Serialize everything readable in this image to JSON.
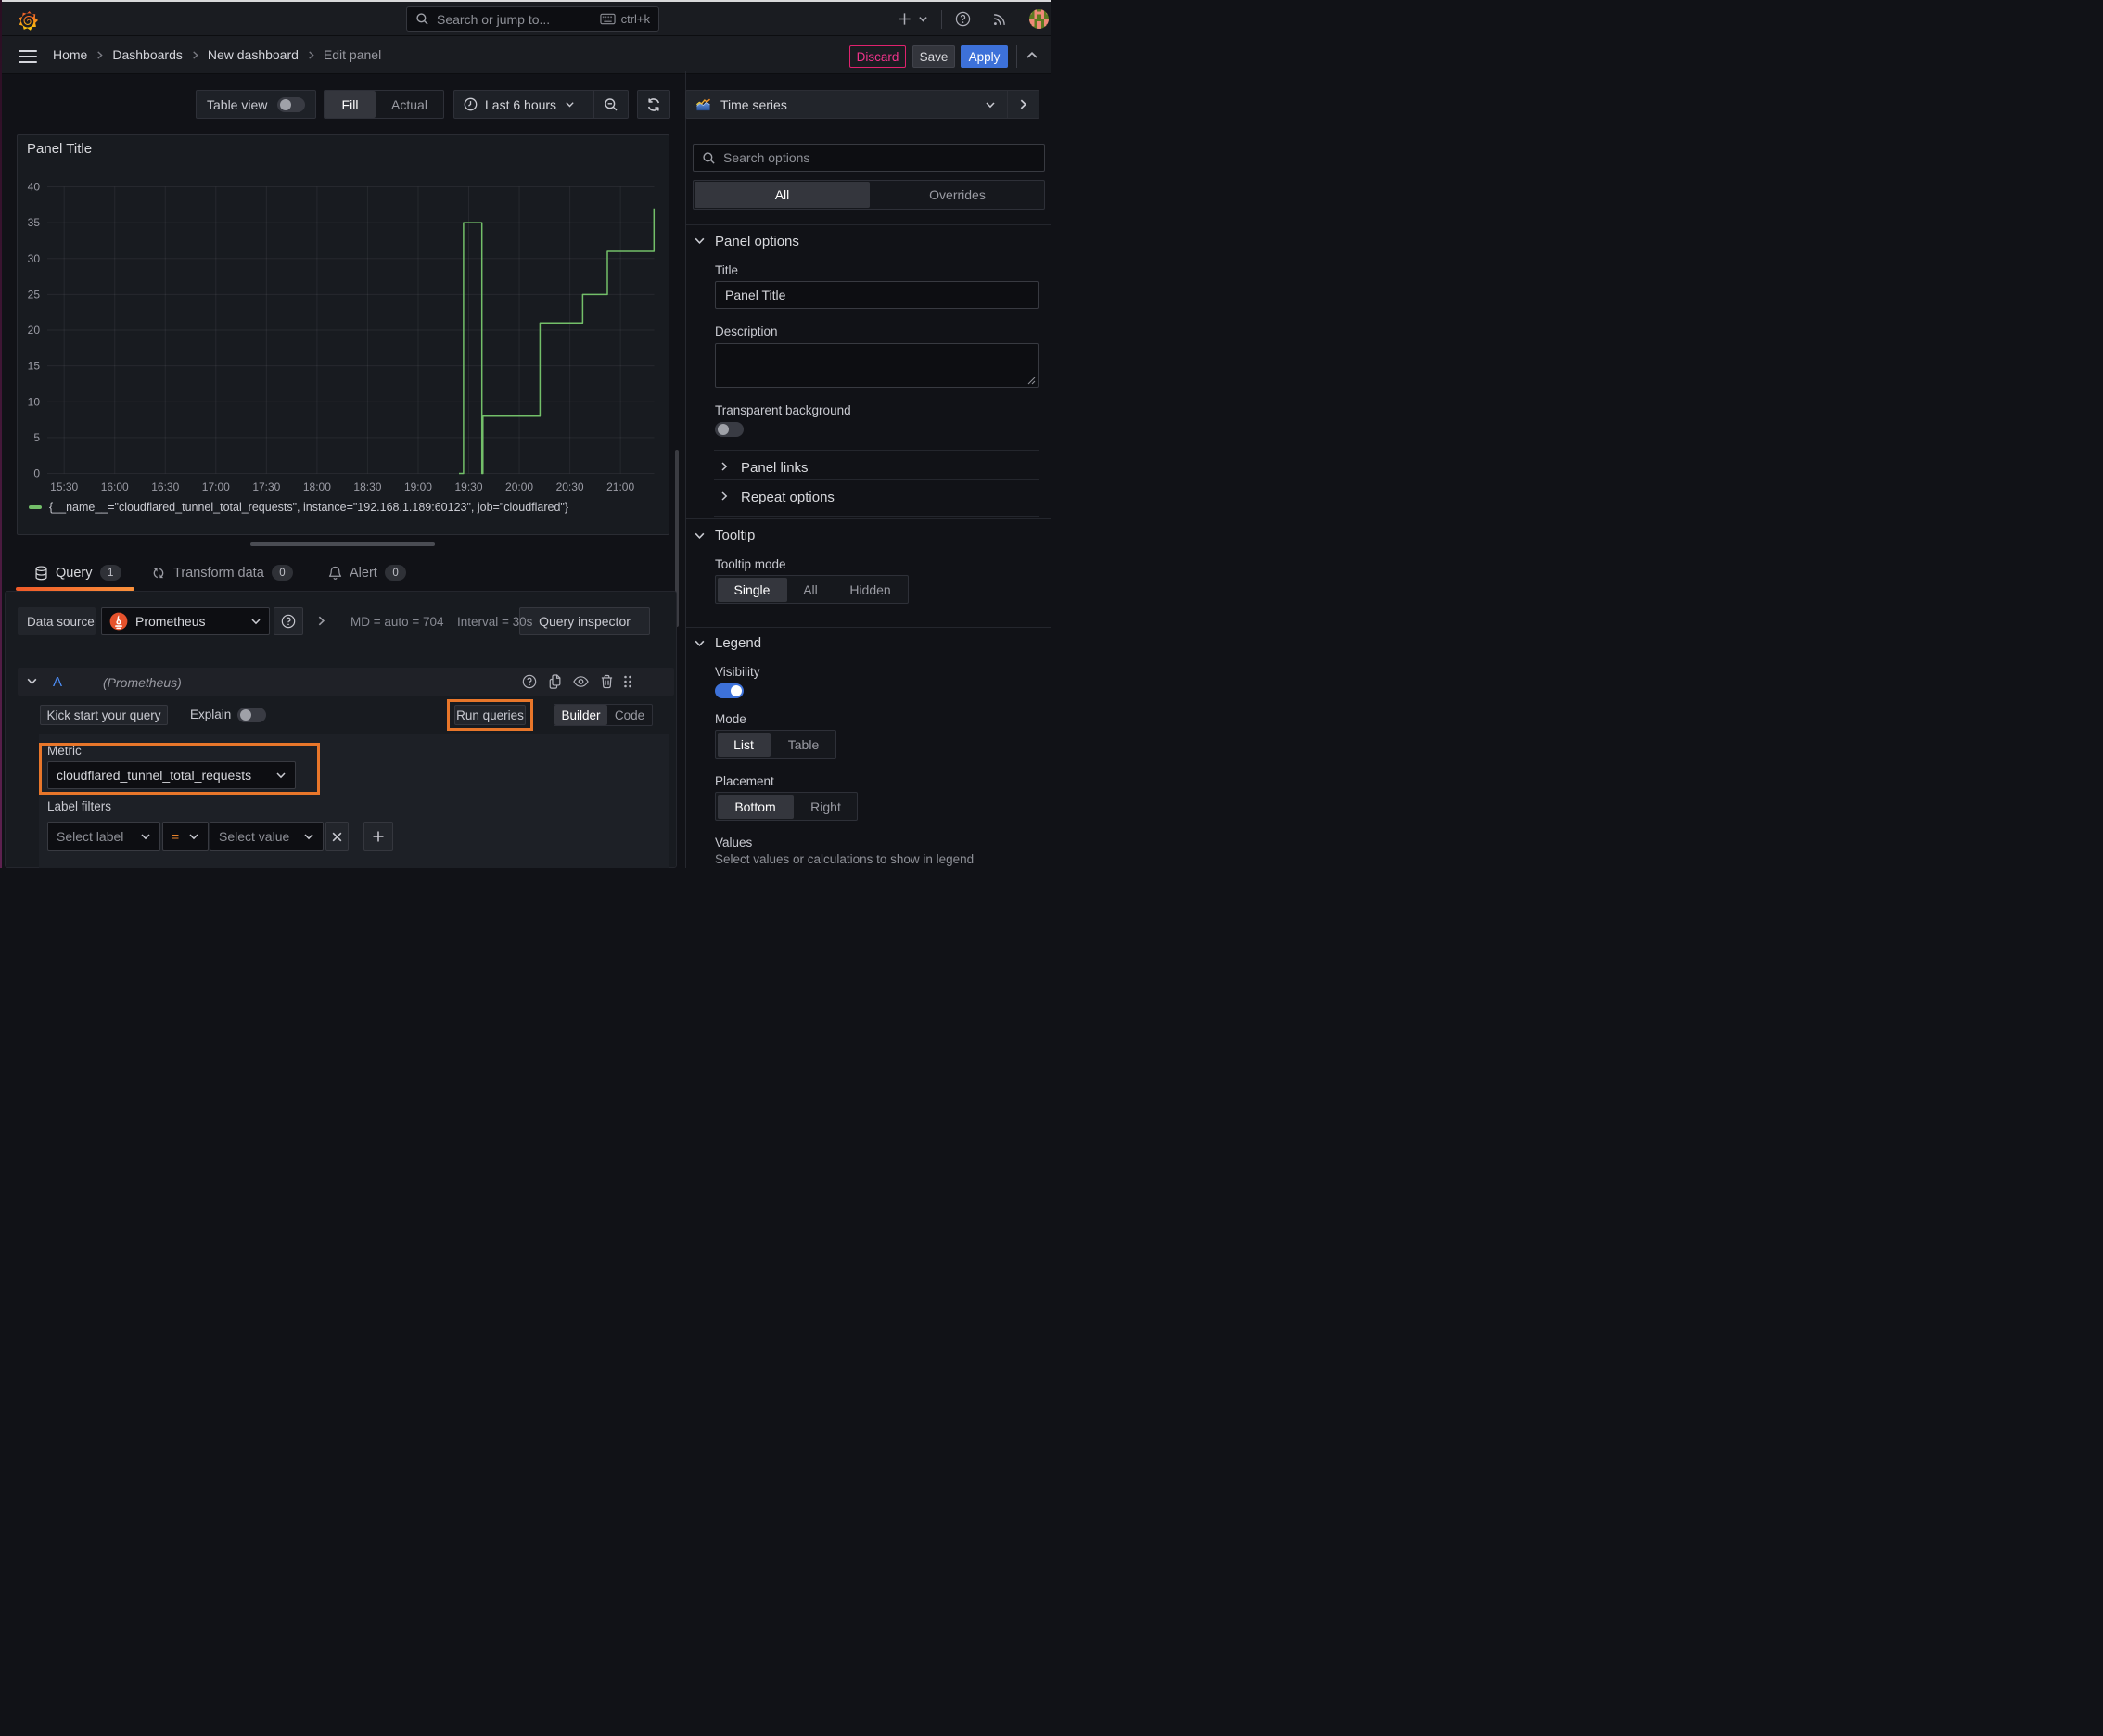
{
  "nav": {
    "search_placeholder": "Search or jump to...",
    "search_shortcut": "ctrl+k"
  },
  "breadcrumb": {
    "items": [
      "Home",
      "Dashboards",
      "New dashboard",
      "Edit panel"
    ],
    "discard_label": "Discard",
    "save_label": "Save",
    "apply_label": "Apply"
  },
  "toolbar": {
    "table_view_label": "Table view",
    "fill_label": "Fill",
    "actual_label": "Actual",
    "time_range_label": "Last 6 hours"
  },
  "panel": {
    "title": "Panel Title"
  },
  "chart_data": {
    "type": "line",
    "line_style": "step",
    "title": "Panel Title",
    "series_label": "{__name__=\"cloudflared_tunnel_total_requests\", instance=\"192.168.1.189:60123\", job=\"cloudflared\"}",
    "color": "#73bf69",
    "grid": true,
    "legend_position": "bottom",
    "x_min_minutes": 920,
    "x_max_minutes": 1280,
    "x_ticks": [
      {
        "minutes": 930,
        "label": "15:30"
      },
      {
        "minutes": 960,
        "label": "16:00"
      },
      {
        "minutes": 990,
        "label": "16:30"
      },
      {
        "minutes": 1020,
        "label": "17:00"
      },
      {
        "minutes": 1050,
        "label": "17:30"
      },
      {
        "minutes": 1080,
        "label": "18:00"
      },
      {
        "minutes": 1110,
        "label": "18:30"
      },
      {
        "minutes": 1140,
        "label": "19:00"
      },
      {
        "minutes": 1170,
        "label": "19:30"
      },
      {
        "minutes": 1200,
        "label": "20:00"
      },
      {
        "minutes": 1230,
        "label": "20:30"
      },
      {
        "minutes": 1260,
        "label": "21:00"
      }
    ],
    "ylim": [
      0,
      40
    ],
    "y_ticks": [
      0,
      5,
      10,
      15,
      20,
      25,
      30,
      35,
      40
    ],
    "points_time_value": [
      [
        1164.2,
        0
      ],
      [
        1166.9,
        0
      ],
      [
        1166.9,
        35
      ],
      [
        1177.8,
        35
      ],
      [
        1177.8,
        0
      ],
      [
        1178.4,
        0
      ],
      [
        1178.4,
        8
      ],
      [
        1212.3,
        8
      ],
      [
        1212.3,
        21
      ],
      [
        1237.6,
        21
      ],
      [
        1237.6,
        25
      ],
      [
        1252.2,
        25
      ],
      [
        1252.2,
        31
      ],
      [
        1279.9,
        31
      ],
      [
        1279.9,
        37
      ]
    ]
  },
  "query_tabs": {
    "query_label": "Query",
    "query_count": "1",
    "transform_label": "Transform data",
    "transform_count": "0",
    "alert_label": "Alert",
    "alert_count": "0"
  },
  "datasource_row": {
    "label": "Data source",
    "name": "Prometheus",
    "stats_md": "MD = auto = 704",
    "stats_interval": "Interval = 30s",
    "inspector_label": "Query inspector"
  },
  "query_row": {
    "ref_id": "A",
    "datasource_hint": "(Prometheus)"
  },
  "query_editor": {
    "kickstart_label": "Kick start your query",
    "explain_label": "Explain",
    "run_label": "Run queries",
    "builder_label": "Builder",
    "code_label": "Code",
    "metric_label": "Metric",
    "metric_value": "cloudflared_tunnel_total_requests",
    "label_filters_label": "Label filters",
    "select_label_placeholder": "Select label",
    "operator": "=",
    "select_value_placeholder": "Select value"
  },
  "viz_picker": {
    "name": "Time series"
  },
  "options": {
    "search_placeholder": "Search options",
    "tab_all": "All",
    "tab_overrides": "Overrides",
    "panel_options": {
      "header": "Panel options",
      "title_label": "Title",
      "title_value": "Panel Title",
      "description_label": "Description",
      "transparent_label": "Transparent background"
    },
    "links_label": "Panel links",
    "repeat_label": "Repeat options",
    "tooltip": {
      "header": "Tooltip",
      "mode_label": "Tooltip mode",
      "opts": [
        "Single",
        "All",
        "Hidden"
      ],
      "selected": "Single"
    },
    "legend": {
      "header": "Legend",
      "visibility_label": "Visibility",
      "mode_label": "Mode",
      "mode_opts": [
        "List",
        "Table"
      ],
      "mode_selected": "List",
      "placement_label": "Placement",
      "placement_opts": [
        "Bottom",
        "Right"
      ],
      "placement_selected": "Bottom",
      "values_label": "Values",
      "values_helper": "Select values or calculations to show in legend"
    }
  },
  "annotation_color": "#e8762a"
}
